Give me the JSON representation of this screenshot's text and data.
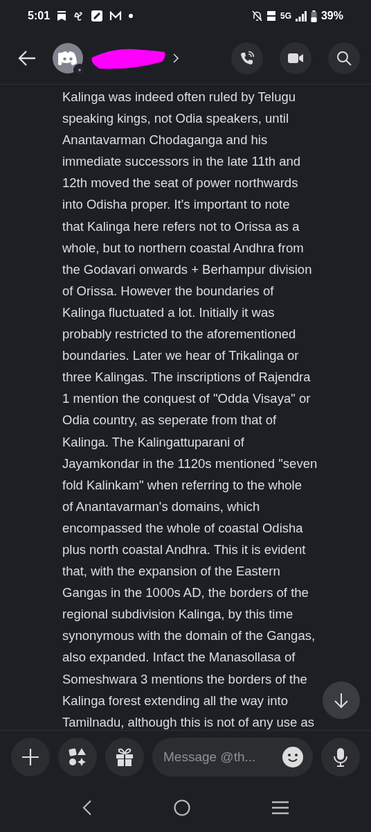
{
  "status_bar": {
    "time": "5:01",
    "battery": "39%",
    "network": "5G"
  },
  "message": {
    "lines": [
      "Kalinga was indeed often ruled by Telugu",
      "speaking kings, not Odia speakers, until",
      "Anantavarman Chodaganga and his",
      "immediate successors in the late 11th and",
      "12th moved the seat of power northwards",
      "into Odisha proper. It's important to note",
      "that Kalinga here refers not to Orissa as a",
      "whole, but to northern coastal Andhra from",
      "the Godavari onwards + Berhampur division",
      "of Orissa. However the boundaries of",
      "Kalinga fluctuated a lot. Initially it was",
      "probably restricted to the aforementioned",
      "boundaries. Later we hear of Trikalinga or",
      "three Kalingas. The inscriptions of Rajendra",
      "1 mention the conquest of \"Odda Visaya\" or",
      "Odia country, as seperate from that of",
      "Kalinga. The Kalingattuparani of",
      "Jayamkondar in the 1120s mentioned \"seven",
      "fold Kalinkam\" when referring to the whole",
      "of Anantavarman's domains, which",
      "encompassed the whole of coastal Odisha",
      "plus north coastal Andhra. This it is evident",
      "that, with the expansion of the Eastern",
      "Gangas in the 1000s AD, the borders of the",
      "regional subdivision Kalinga, by this time",
      "synonymous with the domain of the Gangas,",
      "also expanded. Infact the Manasollasa of",
      "Someshwara 3 mentions the borders of the",
      "Kalinga forest extending all the way into",
      "Tamilnadu, although this is not of any use as"
    ]
  },
  "composer": {
    "placeholder": "Message @th..."
  }
}
